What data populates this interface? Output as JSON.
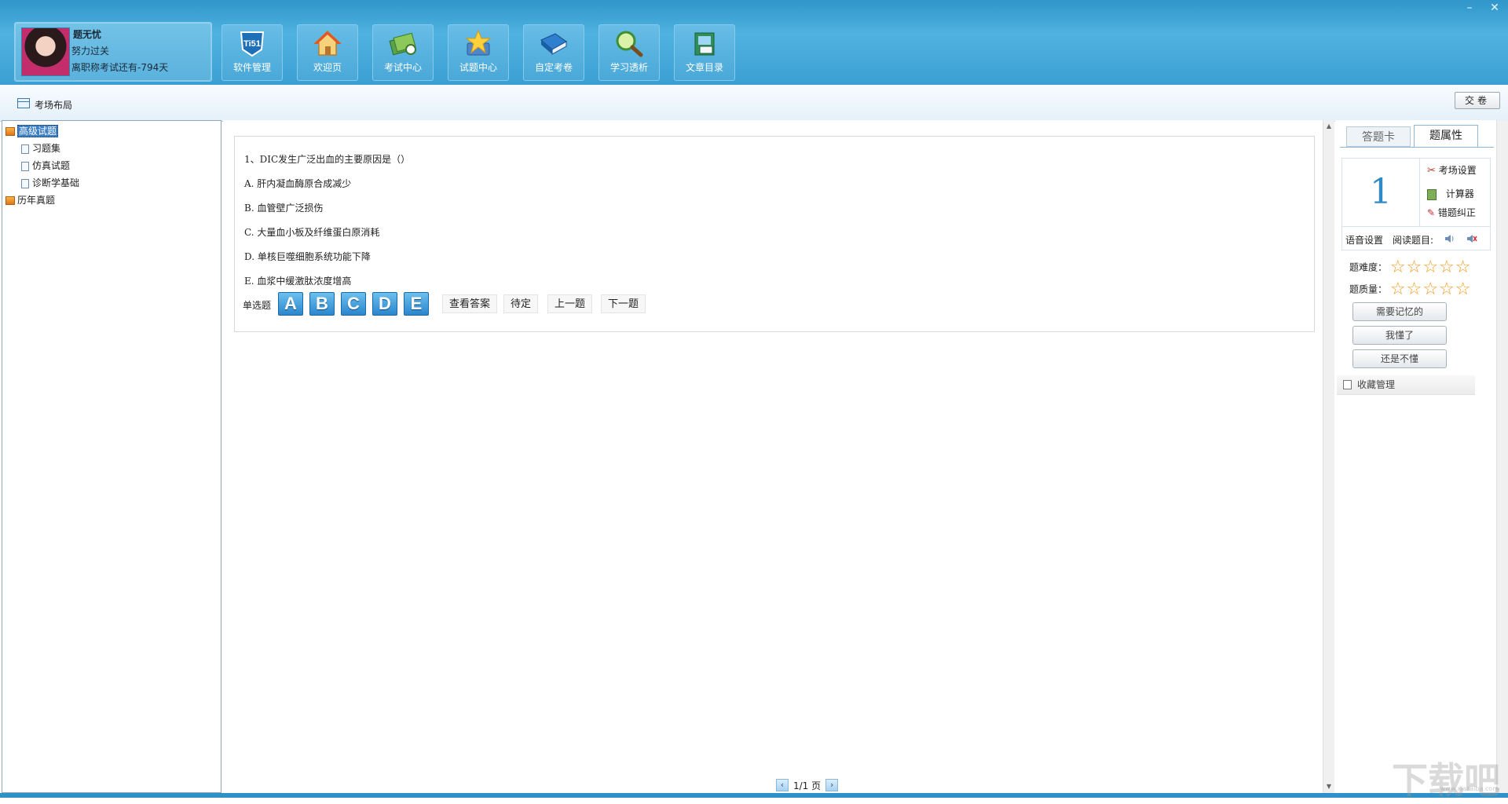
{
  "window": {
    "minimize_icon": "minimize-icon",
    "close_icon": "close-icon"
  },
  "profile": {
    "name": "题无忧",
    "motto": "努力过关",
    "countdown": "离职称考试还有-794天"
  },
  "nav": [
    {
      "label": "软件管理",
      "icon": "ti51-logo-icon"
    },
    {
      "label": "欢迎页",
      "icon": "home-icon"
    },
    {
      "label": "考试中心",
      "icon": "exam-center-icon"
    },
    {
      "label": "试题中心",
      "icon": "star-folder-icon"
    },
    {
      "label": "自定考卷",
      "icon": "book-icon"
    },
    {
      "label": "学习透析",
      "icon": "magnifier-icon"
    },
    {
      "label": "文章目录",
      "icon": "article-icon"
    }
  ],
  "toolbar": {
    "layout_label": "考场布局",
    "submit_label": "交卷"
  },
  "tree": {
    "items": [
      {
        "label": "高级试题",
        "level": 0,
        "type": "folder",
        "selected": true
      },
      {
        "label": "习题集",
        "level": 1,
        "type": "page"
      },
      {
        "label": "仿真试题",
        "level": 1,
        "type": "page"
      },
      {
        "label": "诊断学基础",
        "level": 1,
        "type": "page"
      },
      {
        "label": "历年真题",
        "level": 0,
        "type": "folder"
      }
    ]
  },
  "question": {
    "stem": "1、DIC发生广泛出血的主要原因是（）",
    "options": [
      "A. 肝内凝血酶原合成减少",
      "B. 血管壁广泛损伤",
      "C. 大量血小板及纤维蛋白原消耗",
      "D. 单核巨噬细胞系统功能下降",
      "E. 血浆中缓激肽浓度增高"
    ],
    "type_label": "单选题",
    "answer_buttons": [
      "A",
      "B",
      "C",
      "D",
      "E"
    ],
    "actions": [
      "查看答案",
      "待定",
      "上一题",
      "下一题"
    ]
  },
  "pager": {
    "text": "1/1 页"
  },
  "right_panel": {
    "tabs": [
      "答题卡",
      "题属性"
    ],
    "active_tab": "题属性",
    "question_number": "1",
    "tools": [
      "考场设置",
      "计算器",
      "错题纠正"
    ],
    "voice_setting": "语音设置",
    "read_label": "阅读题目:",
    "difficulty_label": "题难度：",
    "quality_label": "题质量：",
    "difficulty_stars": 0,
    "quality_stars": 0,
    "flag_buttons": [
      "需要记忆的",
      "我懂了",
      "还是不懂"
    ],
    "collect_label": "收藏管理"
  },
  "watermark": {
    "text": "下载吧",
    "sub": "www.xiazaiba.com"
  },
  "colors": {
    "header": "#3b9fd3",
    "accent": "#2f8ac6",
    "star": "#f39a1d",
    "option_button": "#2a86cc"
  }
}
